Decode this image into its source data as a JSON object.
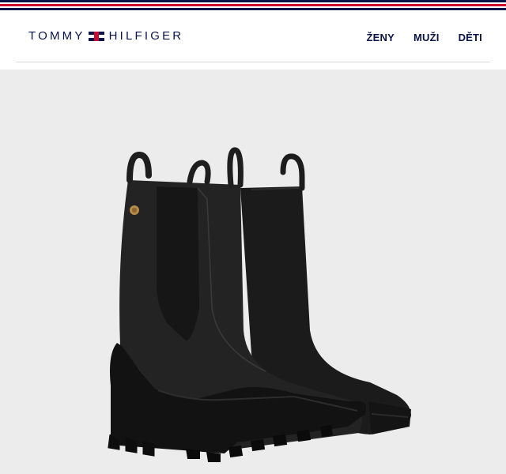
{
  "brand": {
    "left_word": "TOMMY",
    "right_word": "HILFIGER"
  },
  "nav": {
    "items": [
      {
        "label": "ŽENY"
      },
      {
        "label": "MUŽI"
      },
      {
        "label": "DĚTI"
      }
    ]
  },
  "colors": {
    "brand_navy": "#0a1449",
    "brand_red": "#cc0c2f",
    "image_bg": "#ececec"
  },
  "icons": {
    "logo_flag": "tommy-flag-icon"
  }
}
